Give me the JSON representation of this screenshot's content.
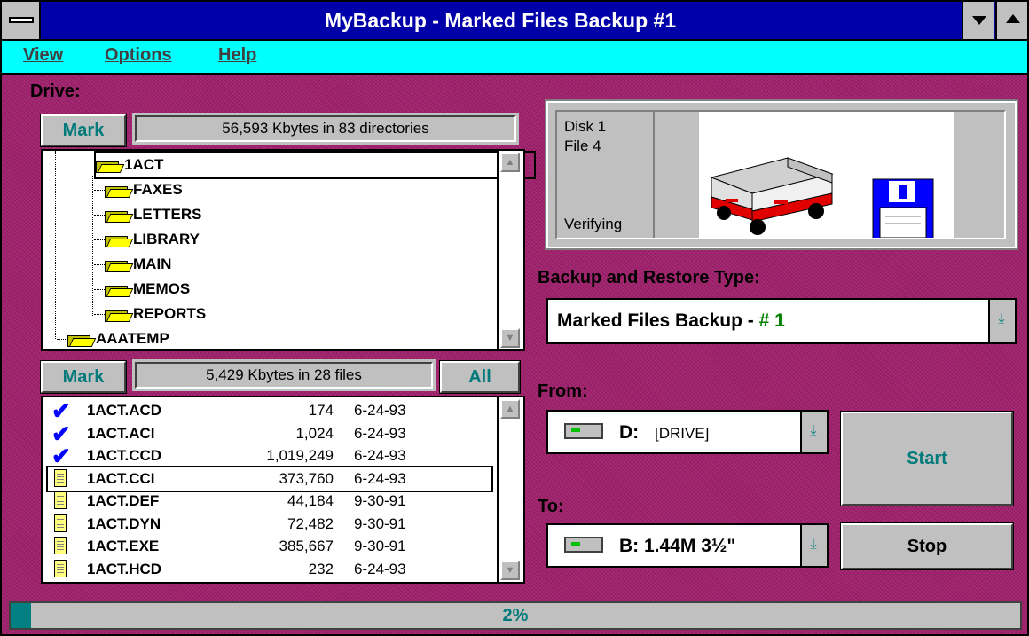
{
  "window": {
    "title": "MyBackup - Marked Files Backup #1"
  },
  "menu": [
    {
      "label": "View"
    },
    {
      "label": "Options"
    },
    {
      "label": "Help"
    }
  ],
  "drive_section": {
    "label": "Drive:",
    "mark_label": "Mark",
    "summary": "56,593 Kbytes in 83 directories",
    "tree": [
      {
        "name": "1ACT",
        "level": 0,
        "selected": true
      },
      {
        "name": "FAXES",
        "level": 1
      },
      {
        "name": "LETTERS",
        "level": 1
      },
      {
        "name": "LIBRARY",
        "level": 1
      },
      {
        "name": "MAIN",
        "level": 1
      },
      {
        "name": "MEMOS",
        "level": 1
      },
      {
        "name": "REPORTS",
        "level": 1
      },
      {
        "name": "AAATEMP",
        "level": 0
      }
    ]
  },
  "files_section": {
    "mark_label": "Mark",
    "summary": "5,429 Kbytes in 28 files",
    "all_label": "All",
    "files": [
      {
        "name": "1ACT.ACD",
        "size": "174",
        "date": "6-24-93",
        "checked": true
      },
      {
        "name": "1ACT.ACI",
        "size": "1,024",
        "date": "6-24-93",
        "checked": true
      },
      {
        "name": "1ACT.CCD",
        "size": "1,019,249",
        "date": "6-24-93",
        "checked": true
      },
      {
        "name": "1ACT.CCI",
        "size": "373,760",
        "date": "6-24-93",
        "checked": false,
        "selected": true
      },
      {
        "name": "1ACT.DEF",
        "size": "44,184",
        "date": "9-30-91",
        "checked": false
      },
      {
        "name": "1ACT.DYN",
        "size": "72,482",
        "date": "9-30-91",
        "checked": false
      },
      {
        "name": "1ACT.EXE",
        "size": "385,667",
        "date": "9-30-91",
        "checked": false
      },
      {
        "name": "1ACT.HCD",
        "size": "232",
        "date": "6-24-93",
        "checked": false
      }
    ]
  },
  "status": {
    "disk": "Disk 1",
    "file": "File 4",
    "state": "Verifying"
  },
  "backup_type": {
    "label": "Backup and Restore Type:",
    "value_prefix": "Marked Files Backup - ",
    "value_number": "# 1"
  },
  "from": {
    "label": "From:",
    "drive": "D:",
    "drive_label": "[DRIVE]"
  },
  "to": {
    "label": "To:",
    "drive": "B: 1.44M 3½\""
  },
  "buttons": {
    "start": "Start",
    "stop": "Stop"
  },
  "progress": {
    "text": "2%",
    "value": 0.02
  },
  "colors": {
    "title_bar": "#0000a8",
    "menu_bar": "#00ffff",
    "background": "#a0206c",
    "accent_teal": "#007a7a"
  }
}
